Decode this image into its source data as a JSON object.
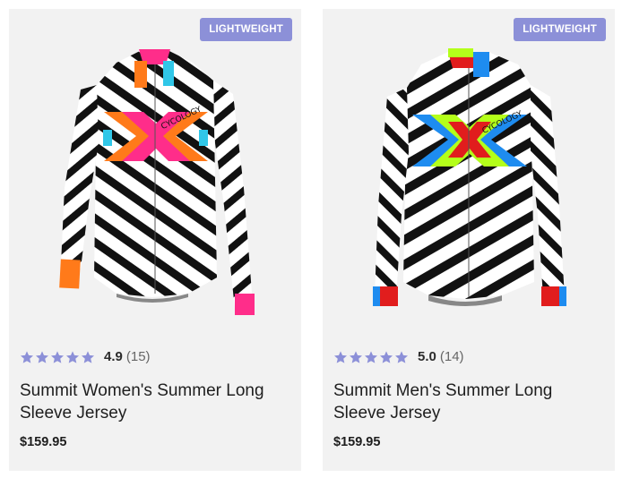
{
  "products": [
    {
      "badge": "LIGHTWEIGHT",
      "rating": "4.9",
      "review_count": "(15)",
      "title": "Summit Women's Summer Long Sleeve Jersey",
      "price": "$159.95",
      "image_alt": "women-jersey-image",
      "accent_colors": [
        "#ff7a1a",
        "#ff2d8a",
        "#30c7e8"
      ],
      "logo_text": "CYCOLOGY"
    },
    {
      "badge": "LIGHTWEIGHT",
      "rating": "5.0",
      "review_count": "(14)",
      "title": "Summit Men's Summer Long Sleeve Jersey",
      "price": "$159.95",
      "image_alt": "men-jersey-image",
      "accent_colors": [
        "#e11d1d",
        "#1e8cf0",
        "#b4ff1a"
      ],
      "logo_text": "CYCOLOGY"
    }
  ],
  "colors": {
    "badge": "#8c90d8",
    "star": "#8c90d8",
    "card_bg": "#f2f2f2"
  }
}
